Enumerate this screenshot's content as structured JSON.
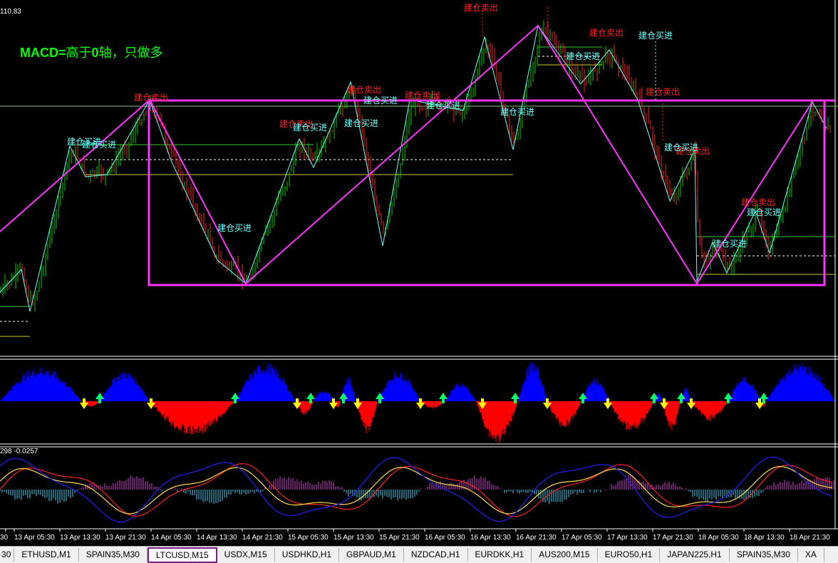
{
  "chart": {
    "price_label": "110.83",
    "macd_text": "MACD=",
    "macd_note": "高于",
    "macd_zero": "0",
    "macd_tail": "轴，只做多",
    "osc_label": "298 -0.0257",
    "buy_label": "建仓买进",
    "sell_label": "建仓卖出",
    "colors": {
      "box": "#ff33ff",
      "zigzag": "#ff33ff",
      "up_hist": "#0000ff",
      "down_hist": "#ff0000",
      "buy": "#66ffff",
      "sell": "#ff2020",
      "macd_text": "#00ff00"
    }
  },
  "signals": [
    {
      "type": "sell"
    },
    {
      "type": "buy"
    },
    {
      "type": "sell"
    },
    {
      "type": "buy"
    },
    {
      "type": "sell"
    },
    {
      "type": "buy"
    },
    {
      "type": "buy"
    },
    {
      "type": "sell"
    },
    {
      "type": "buy"
    },
    {
      "type": "buy"
    },
    {
      "type": "sell"
    },
    {
      "type": "buy"
    },
    {
      "type": "buy"
    },
    {
      "type": "sell"
    },
    {
      "type": "buy"
    },
    {
      "type": "sell"
    },
    {
      "type": "buy"
    },
    {
      "type": "sell"
    },
    {
      "type": "buy"
    },
    {
      "type": "sell"
    },
    {
      "type": "buy"
    },
    {
      "type": "buy"
    }
  ],
  "time_axis": [
    "30",
    "13 Apr 05:30",
    "13 Apr 13:30",
    "13 Apr 21:30",
    "14 Apr 05:30",
    "14 Apr 13:30",
    "14 Apr 21:30",
    "15 Apr 05:30",
    "15 Apr 13:30",
    "15 Apr 21:30",
    "16 Apr 05:30",
    "16 Apr 13:30",
    "16 Apr 21:30",
    "17 Apr 05:30",
    "17 Apr 13:30",
    "17 Apr 21:30",
    "18 Apr 05:30",
    "18 Apr 13:30",
    "18 Apr 21:30"
  ],
  "tabs": [
    {
      "label": "30"
    },
    {
      "label": "ETHUSD,M1"
    },
    {
      "label": "SPAIN35,M30"
    },
    {
      "label": "LTCUSD,M15",
      "active": true
    },
    {
      "label": "USDX,M15"
    },
    {
      "label": "USDHKD,H1"
    },
    {
      "label": "GBPAUD,M1"
    },
    {
      "label": "NZDCAD,H1"
    },
    {
      "label": "EURDKK,H1"
    },
    {
      "label": "AUS200,M15"
    },
    {
      "label": "EURO50,H1"
    },
    {
      "label": "JAPAN225,H1"
    },
    {
      "label": "SPAIN35,M30"
    },
    {
      "label": "XA"
    }
  ]
}
